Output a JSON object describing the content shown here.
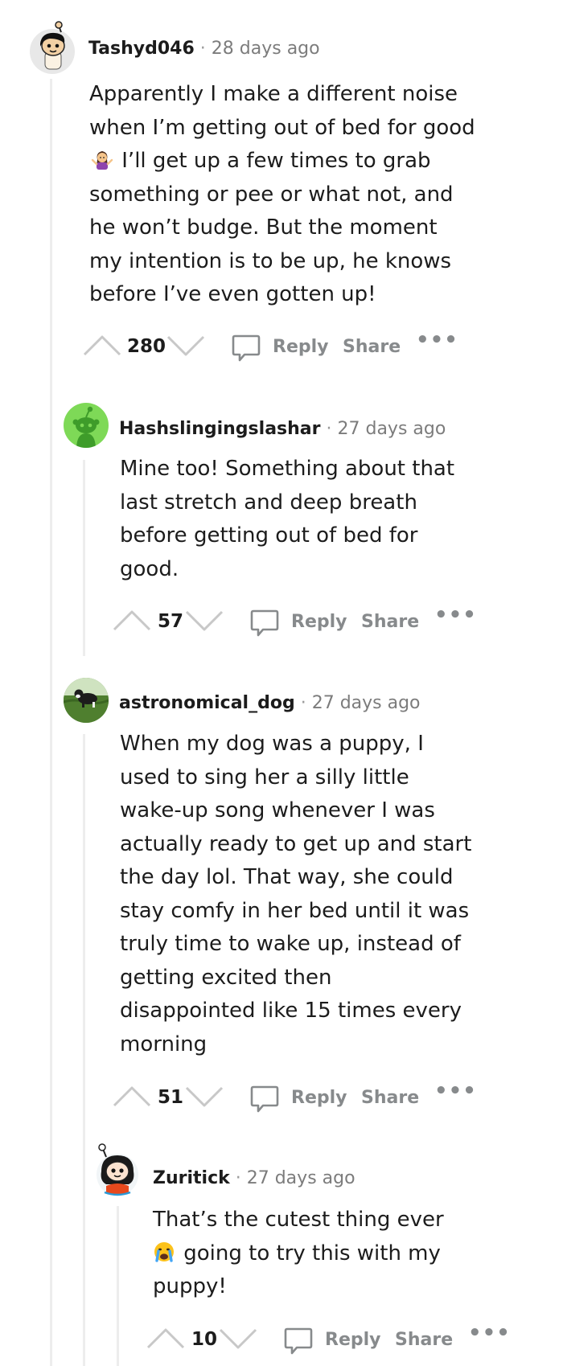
{
  "comments": [
    {
      "author": "Tashyd046",
      "time": "28 days ago",
      "body": "Apparently I make a different noise when I’m getting out of bed for good",
      "body_after_emoji": " I’ll get up a few times to grab something or pee or what not, and he won’t budge. But the moment my intention is to be up, he knows before I’ve even gotten up!",
      "emoji": "woman-shrugging-emoji",
      "score": "280",
      "reply_label": "Reply",
      "share_label": "Share",
      "more_label": "•••"
    },
    {
      "author": "Hashslingingslashar",
      "time": "27 days ago",
      "body": "Mine too! Something about that last stretch and deep breath before getting out of bed for good.",
      "score": "57",
      "reply_label": "Reply",
      "share_label": "Share",
      "more_label": "•••"
    },
    {
      "author": "astronomical_dog",
      "time": "27 days ago",
      "body": "When my dog was a puppy, I used to sing her a silly little wake-up song whenever I was actually ready to get up and start the day lol. That way, she could stay comfy in her bed until it was truly time to wake up, instead of getting excited then disappointed like 15 times every morning",
      "score": "51",
      "reply_label": "Reply",
      "share_label": "Share",
      "more_label": "•••"
    },
    {
      "author": "Zuritick",
      "time": "27 days ago",
      "body_before_emoji": "That’s the cutest thing ever",
      "emoji": "crying-face-emoji",
      "body": " going to try this with my puppy!",
      "score": "10",
      "reply_label": "Reply",
      "share_label": "Share",
      "more_label": "•••"
    }
  ],
  "meta_separator": "·",
  "colors": {
    "thread_line": "#ededed",
    "meta_text": "#7c7c7c",
    "action_text": "#878a8c",
    "avatar_green": "#7ed957"
  }
}
